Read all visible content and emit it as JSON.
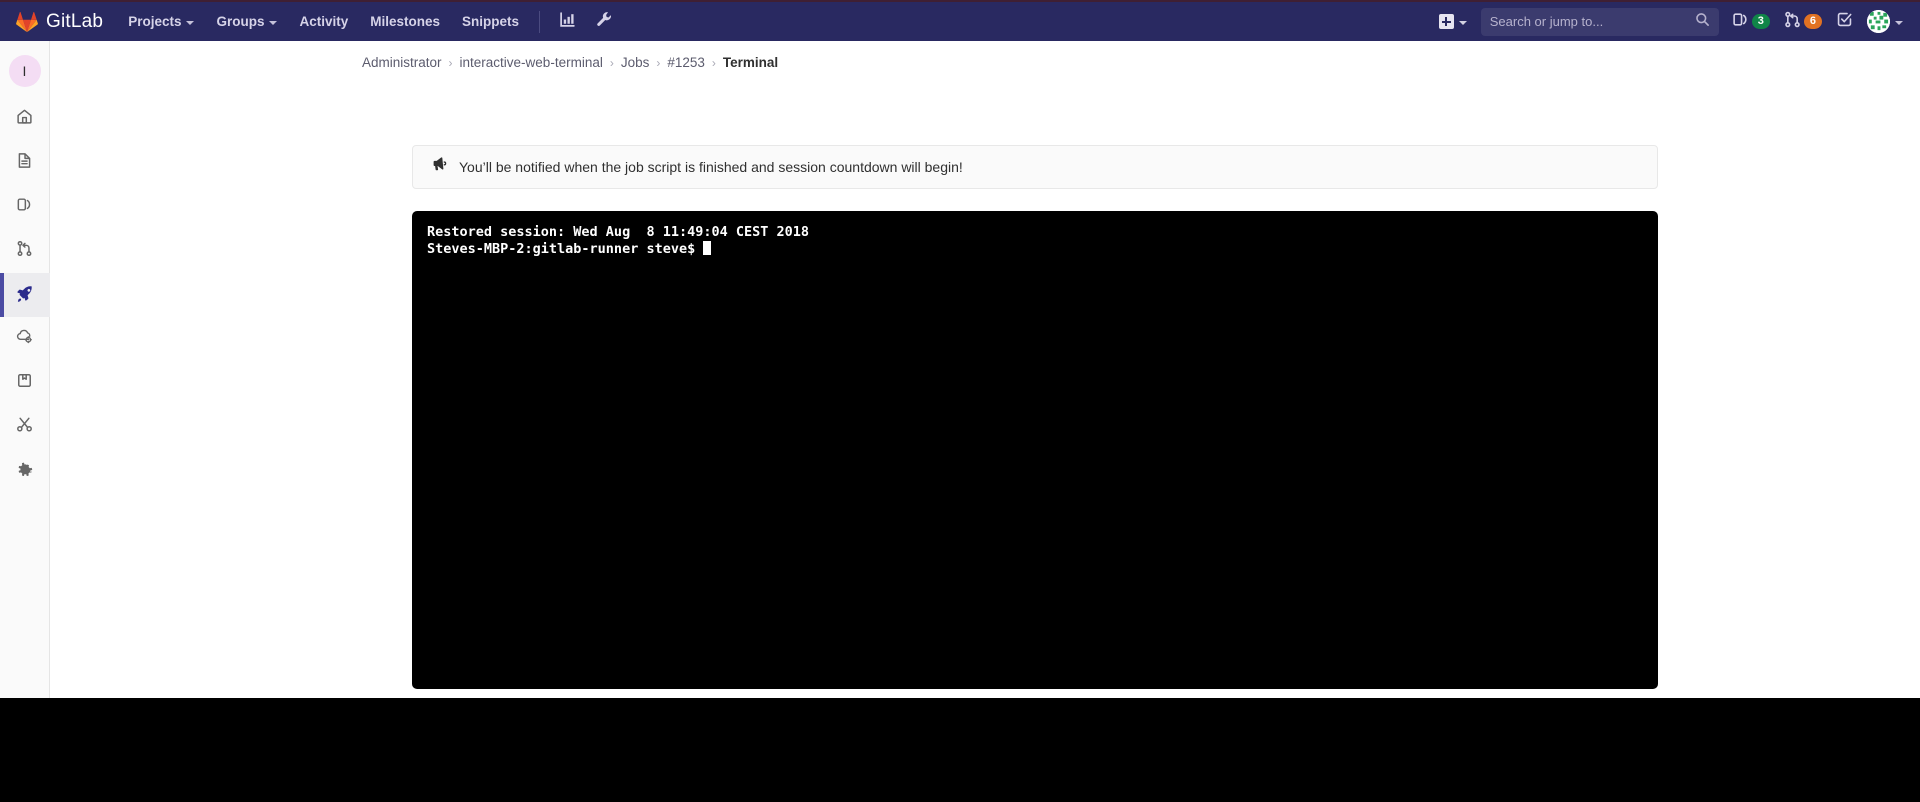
{
  "navbar": {
    "brand": "GitLab",
    "brand_logo_icon": "gitlab-fox-logo",
    "items": [
      {
        "label": "Projects",
        "has_caret": true
      },
      {
        "label": "Groups",
        "has_caret": true
      },
      {
        "label": "Activity",
        "has_caret": false
      },
      {
        "label": "Milestones",
        "has_caret": false
      },
      {
        "label": "Snippets",
        "has_caret": false
      }
    ],
    "analytics_icon": "chart-bar-icon",
    "admin_icon": "wrench-icon",
    "new_icon": "plus-square-icon",
    "new_caret_icon": "chevron-down-icon",
    "search": {
      "placeholder": "Search or jump to...",
      "value": "",
      "icon": "search-icon"
    },
    "issues": {
      "icon": "issues-icon",
      "count": "3",
      "color": "#108548"
    },
    "merge_requests": {
      "icon": "merge-request-icon",
      "count": "6",
      "color": "#e17223"
    },
    "todos": {
      "icon": "todo-check-icon"
    },
    "avatar": {
      "icon": "user-avatar-identicon",
      "caret_icon": "chevron-down-icon"
    }
  },
  "sidebar": {
    "project_avatar_letter": "I",
    "items": [
      {
        "name": "overview",
        "icon": "home-icon",
        "active": false
      },
      {
        "name": "repository",
        "icon": "document-icon",
        "active": false
      },
      {
        "name": "issues",
        "icon": "issues-icon",
        "active": false
      },
      {
        "name": "merge-requests",
        "icon": "merge-request-icon",
        "active": false
      },
      {
        "name": "ci-cd",
        "icon": "rocket-icon",
        "active": true
      },
      {
        "name": "operations",
        "icon": "cloud-gear-icon",
        "active": false
      },
      {
        "name": "packages",
        "icon": "package-icon",
        "active": false
      },
      {
        "name": "snippets",
        "icon": "scissors-icon",
        "active": false
      },
      {
        "name": "settings",
        "icon": "gear-icon",
        "active": false
      }
    ]
  },
  "breadcrumb": [
    {
      "label": "Administrator",
      "current": false
    },
    {
      "label": "interactive-web-terminal",
      "current": false
    },
    {
      "label": "Jobs",
      "current": false
    },
    {
      "label": "#1253",
      "current": false
    },
    {
      "label": "Terminal",
      "current": true
    }
  ],
  "breadcrumb_separator": "›",
  "alert": {
    "icon": "megaphone-icon",
    "message": "You’ll be notified when the job script is finished and session countdown will begin!"
  },
  "terminal": {
    "lines": [
      "Restored session: Wed Aug  8 11:49:04 CEST 2018",
      "Steves-MBP-2:gitlab-runner steve$ "
    ],
    "cursor_visible": true,
    "background": "#000000",
    "foreground": "#ffffff"
  }
}
